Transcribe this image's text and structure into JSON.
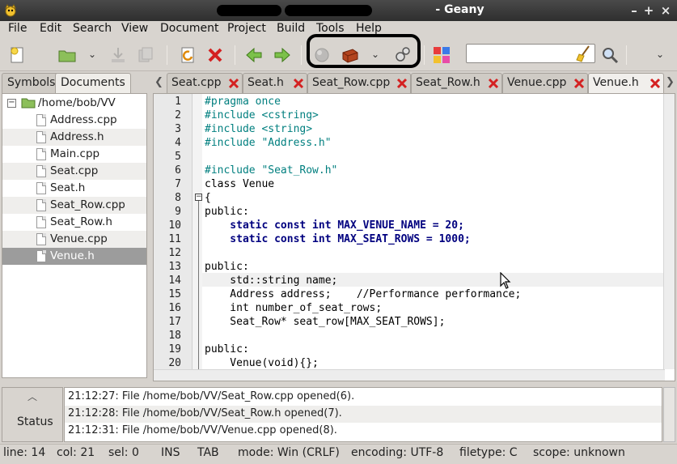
{
  "window": {
    "title": "- Geany",
    "minimize": "–",
    "maximize": "+",
    "close": "×"
  },
  "menu": [
    "File",
    "Edit",
    "Search",
    "View",
    "Document",
    "Project",
    "Build",
    "Tools",
    "Help"
  ],
  "toolbar": {
    "search_value": "",
    "icons": [
      "new-file-icon",
      "open-file-icon",
      "save-icon",
      "save-all-icon",
      "revert-icon",
      "close-file-icon",
      "back-icon",
      "forward-icon",
      "compile-icon",
      "build-icon",
      "execute-icon",
      "color-chooser-icon",
      "clear-search-icon",
      "find-icon"
    ]
  },
  "sidebar": {
    "tabs": [
      "Symbols",
      "Documents"
    ],
    "folder": "/home/bob/VV",
    "files": [
      "Address.cpp",
      "Address.h",
      "Main.cpp",
      "Seat.cpp",
      "Seat.h",
      "Seat_Row.cpp",
      "Seat_Row.h",
      "Venue.cpp",
      "Venue.h"
    ],
    "selected": "Venue.h"
  },
  "tabs": [
    "Seat.cpp",
    "Seat.h",
    "Seat_Row.cpp",
    "Seat_Row.h",
    "Venue.cpp",
    "Venue.h"
  ],
  "active_tab": "Venue.h",
  "editor": {
    "line_numbers": [
      "1",
      "2",
      "3",
      "4",
      "5",
      "6",
      "7",
      "8",
      "9",
      "10",
      "11",
      "12",
      "13",
      "14",
      "15",
      "16",
      "17",
      "18",
      "19",
      "20"
    ],
    "code": [
      "#pragma once",
      "#include <cstring>",
      "#include <string>",
      "#include \"Address.h\"",
      "",
      "#include \"Seat_Row.h\"",
      "class Venue",
      "{",
      "public:",
      "    static const int MAX_VENUE_NAME = 20;",
      "    static const int MAX_SEAT_ROWS = 1000;",
      "",
      "public:",
      "    std::string name;",
      "    Address address;    //Performance performance;",
      "    int number_of_seat_rows;",
      "    Seat_Row* seat_row[MAX_SEAT_ROWS];",
      "",
      "public:",
      "    Venue(void){};"
    ]
  },
  "messages": {
    "tab": "Status",
    "lines": [
      "21:12:27: File /home/bob/VV/Seat_Row.cpp opened(6).",
      "21:12:28: File /home/bob/VV/Seat_Row.h opened(7).",
      "21:12:31: File /home/bob/VV/Venue.cpp opened(8)."
    ]
  },
  "statusbar": {
    "line": "line: 14",
    "col": "col: 21",
    "sel": "sel: 0",
    "ins": "INS",
    "tab": "TAB",
    "mode": "mode: Win (CRLF)",
    "encoding": "encoding: UTF-8",
    "filetype": "filetype: C",
    "scope": "scope: unknown"
  }
}
